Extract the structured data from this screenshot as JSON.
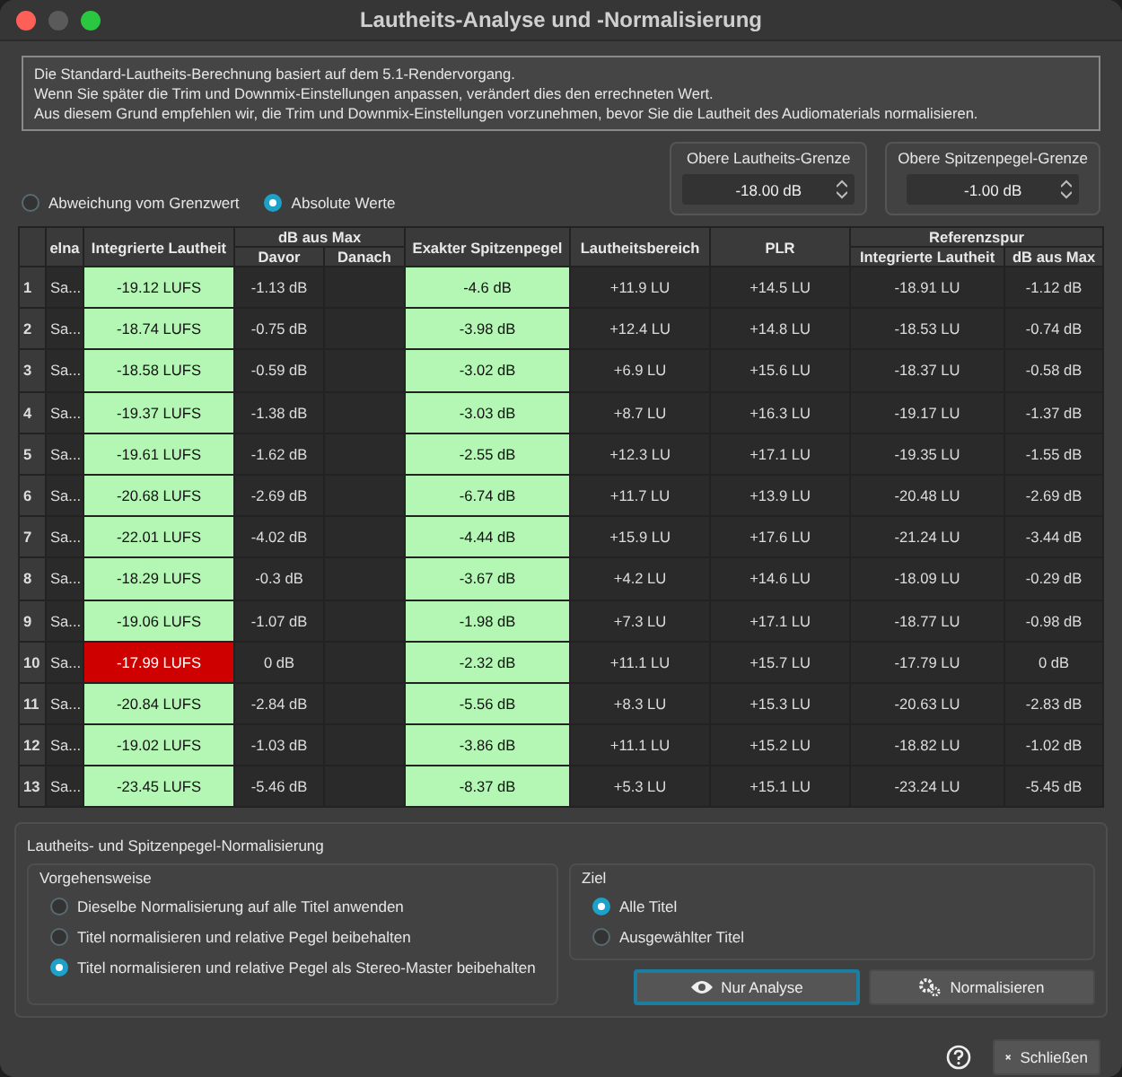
{
  "window": {
    "title": "Lautheits-Analyse und -Normalisierung"
  },
  "info_lines": [
    "Die Standard-Lautheits-Berechnung basiert auf dem 5.1-Rendervorgang.",
    "Wenn Sie später die Trim und Downmix-Einstellungen anpassen, verändert dies den errechneten Wert.",
    "Aus diesem Grund empfehlen wir, die Trim und Downmix-Einstellungen vorzunehmen, bevor Sie die Lautheit des Audiomaterials normalisieren."
  ],
  "limits": [
    {
      "label": "Obere Lautheits-Grenze",
      "value": "-18.00 dB"
    },
    {
      "label": "Obere Spitzenpegel-Grenze",
      "value": "-1.00 dB"
    }
  ],
  "display_mode": [
    {
      "label": "Abweichung vom Grenzwert",
      "selected": false
    },
    {
      "label": "Absolute Werte",
      "selected": true
    }
  ],
  "table": {
    "columns": {
      "name": "elna",
      "integrated": "Integrierte Lautheit",
      "db_from_max": "dB aus Max",
      "before": "Davor",
      "after": "Danach",
      "true_peak": "Exakter Spitzenpegel",
      "range": "Lautheitsbereich",
      "plr": "PLR",
      "reference": "Referenzspur",
      "ref_integrated": "Integrierte Lautheit",
      "ref_db_from_max": "dB aus Max"
    },
    "rows": [
      {
        "index": "1",
        "name": "Sa...",
        "integrated": "-19.12 LUFS",
        "integrated_over_limit": false,
        "before": "-1.13 dB",
        "true_peak": "-4.6 dB",
        "peak_over_limit": false,
        "range": "+11.9 LU",
        "plr": "+14.5 LU",
        "ref_integrated": "-18.91 LU",
        "ref_db_from_max": "-1.12 dB"
      },
      {
        "index": "2",
        "name": "Sa...",
        "integrated": "-18.74 LUFS",
        "integrated_over_limit": false,
        "before": "-0.75 dB",
        "true_peak": "-3.98 dB",
        "peak_over_limit": false,
        "range": "+12.4 LU",
        "plr": "+14.8 LU",
        "ref_integrated": "-18.53 LU",
        "ref_db_from_max": "-0.74 dB"
      },
      {
        "index": "3",
        "name": "Sa...",
        "integrated": "-18.58 LUFS",
        "integrated_over_limit": false,
        "before": "-0.59 dB",
        "true_peak": "-3.02 dB",
        "peak_over_limit": false,
        "range": "+6.9 LU",
        "plr": "+15.6 LU",
        "ref_integrated": "-18.37 LU",
        "ref_db_from_max": "-0.58 dB"
      },
      {
        "index": "4",
        "name": "Sa...",
        "integrated": "-19.37 LUFS",
        "integrated_over_limit": false,
        "before": "-1.38 dB",
        "true_peak": "-3.03 dB",
        "peak_over_limit": false,
        "range": "+8.7 LU",
        "plr": "+16.3 LU",
        "ref_integrated": "-19.17 LU",
        "ref_db_from_max": "-1.37 dB"
      },
      {
        "index": "5",
        "name": "Sa...",
        "integrated": "-19.61 LUFS",
        "integrated_over_limit": false,
        "before": "-1.62 dB",
        "true_peak": "-2.55 dB",
        "peak_over_limit": false,
        "range": "+12.3 LU",
        "plr": "+17.1 LU",
        "ref_integrated": "-19.35 LU",
        "ref_db_from_max": "-1.55 dB"
      },
      {
        "index": "6",
        "name": "Sa...",
        "integrated": "-20.68 LUFS",
        "integrated_over_limit": false,
        "before": "-2.69 dB",
        "true_peak": "-6.74 dB",
        "peak_over_limit": false,
        "range": "+11.7 LU",
        "plr": "+13.9 LU",
        "ref_integrated": "-20.48 LU",
        "ref_db_from_max": "-2.69 dB"
      },
      {
        "index": "7",
        "name": "Sa...",
        "integrated": "-22.01 LUFS",
        "integrated_over_limit": false,
        "before": "-4.02 dB",
        "true_peak": "-4.44 dB",
        "peak_over_limit": false,
        "range": "+15.9 LU",
        "plr": "+17.6 LU",
        "ref_integrated": "-21.24 LU",
        "ref_db_from_max": "-3.44 dB"
      },
      {
        "index": "8",
        "name": "Sa...",
        "integrated": "-18.29 LUFS",
        "integrated_over_limit": false,
        "before": "-0.3 dB",
        "true_peak": "-3.67 dB",
        "peak_over_limit": false,
        "range": "+4.2 LU",
        "plr": "+14.6 LU",
        "ref_integrated": "-18.09 LU",
        "ref_db_from_max": "-0.29 dB"
      },
      {
        "index": "9",
        "name": "Sa...",
        "integrated": "-19.06 LUFS",
        "integrated_over_limit": false,
        "before": "-1.07 dB",
        "true_peak": "-1.98 dB",
        "peak_over_limit": false,
        "range": "+7.3 LU",
        "plr": "+17.1 LU",
        "ref_integrated": "-18.77 LU",
        "ref_db_from_max": "-0.98 dB"
      },
      {
        "index": "10",
        "name": "Sa...",
        "integrated": "-17.99 LUFS",
        "integrated_over_limit": true,
        "before": "0 dB",
        "true_peak": "-2.32 dB",
        "peak_over_limit": false,
        "range": "+11.1 LU",
        "plr": "+15.7 LU",
        "ref_integrated": "-17.79 LU",
        "ref_db_from_max": "0 dB"
      },
      {
        "index": "11",
        "name": "Sa...",
        "integrated": "-20.84 LUFS",
        "integrated_over_limit": false,
        "before": "-2.84 dB",
        "true_peak": "-5.56 dB",
        "peak_over_limit": false,
        "range": "+8.3 LU",
        "plr": "+15.3 LU",
        "ref_integrated": "-20.63 LU",
        "ref_db_from_max": "-2.83 dB"
      },
      {
        "index": "12",
        "name": "Sa...",
        "integrated": "-19.02 LUFS",
        "integrated_over_limit": false,
        "before": "-1.03 dB",
        "true_peak": "-3.86 dB",
        "peak_over_limit": false,
        "range": "+11.1 LU",
        "plr": "+15.2 LU",
        "ref_integrated": "-18.82 LU",
        "ref_db_from_max": "-1.02 dB"
      },
      {
        "index": "13",
        "name": "Sa...",
        "integrated": "-23.45 LUFS",
        "integrated_over_limit": false,
        "before": "-5.46 dB",
        "true_peak": "-8.37 dB",
        "peak_over_limit": false,
        "range": "+5.3 LU",
        "plr": "+15.1 LU",
        "ref_integrated": "-23.24 LU",
        "ref_db_from_max": "-5.45 dB"
      }
    ]
  },
  "normalization": {
    "title": "Lautheits- und Spitzenpegel-Normalisierung",
    "method": {
      "title": "Vorgehensweise",
      "options": [
        {
          "label": "Dieselbe Normalisierung auf alle Titel anwenden",
          "selected": false
        },
        {
          "label": "Titel normalisieren und relative Pegel beibehalten",
          "selected": false
        },
        {
          "label": "Titel normalisieren und relative Pegel als Stereo-Master beibehalten",
          "selected": true
        }
      ]
    },
    "target": {
      "title": "Ziel",
      "options": [
        {
          "label": "Alle Titel",
          "selected": true
        },
        {
          "label": "Ausgewählter Titel",
          "selected": false
        }
      ]
    },
    "buttons": [
      {
        "kind": "analyze",
        "label": "Nur Analyse",
        "focused": true
      },
      {
        "kind": "normalize",
        "label": "Normalisieren",
        "focused": false
      }
    ]
  },
  "footer": {
    "close_label": "Schließen"
  }
}
